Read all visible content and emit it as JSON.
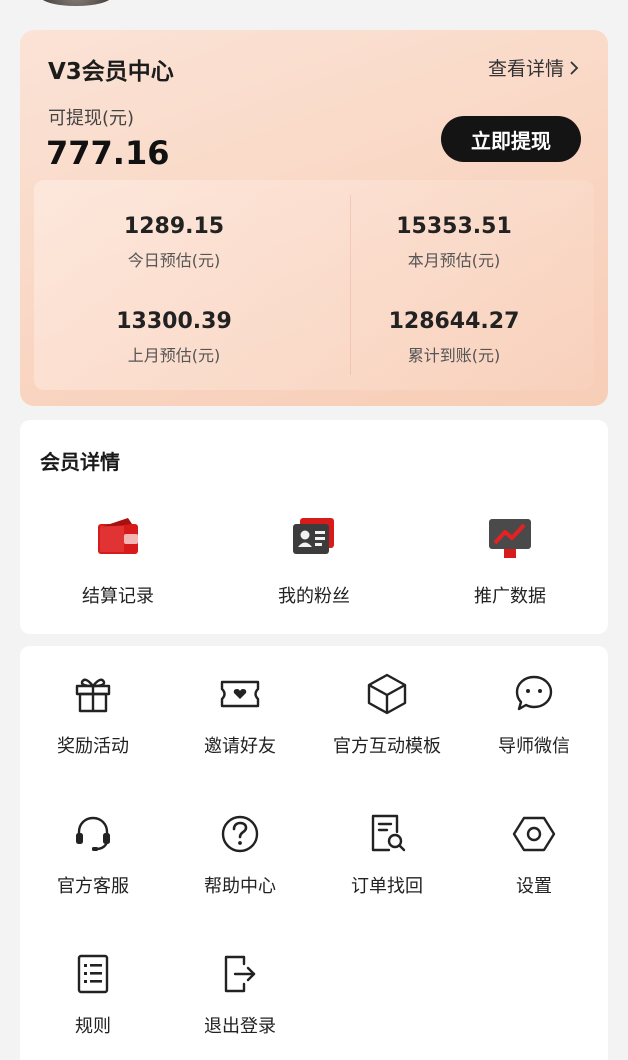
{
  "vip": {
    "title": "V3会员中心",
    "detail_link": "查看详情",
    "withdrawable_label": "可提现(元)",
    "withdrawable_value": "777.16",
    "withdraw_button": "立即提现",
    "stats": [
      {
        "value": "1289.15",
        "label": "今日预估(元)"
      },
      {
        "value": "15353.51",
        "label": "本月预估(元)"
      },
      {
        "value": "13300.39",
        "label": "上月预估(元)"
      },
      {
        "value": "128644.27",
        "label": "累计到账(元)"
      }
    ],
    "colors": {
      "accent": "#d81e1e",
      "button": "#141414",
      "card": "#f9d6c3"
    }
  },
  "member_details": {
    "title": "会员详情",
    "items": [
      {
        "label": "结算记录",
        "icon": "wallet-icon"
      },
      {
        "label": "我的粉丝",
        "icon": "id-card-icon"
      },
      {
        "label": "推广数据",
        "icon": "chart-icon"
      }
    ]
  },
  "tools": {
    "items": [
      {
        "label": "奖励活动",
        "icon": "gift-icon"
      },
      {
        "label": "邀请好友",
        "icon": "ticket-heart-icon"
      },
      {
        "label": "官方互动模板",
        "icon": "box-icon"
      },
      {
        "label": "导师微信",
        "icon": "chat-bubble-icon"
      },
      {
        "label": "官方客服",
        "icon": "headset-icon"
      },
      {
        "label": "帮助中心",
        "icon": "help-circle-icon"
      },
      {
        "label": "订单找回",
        "icon": "document-search-icon"
      },
      {
        "label": "设置",
        "icon": "settings-hexagon-icon"
      },
      {
        "label": "规则",
        "icon": "list-document-icon"
      },
      {
        "label": "退出登录",
        "icon": "logout-icon"
      }
    ]
  }
}
